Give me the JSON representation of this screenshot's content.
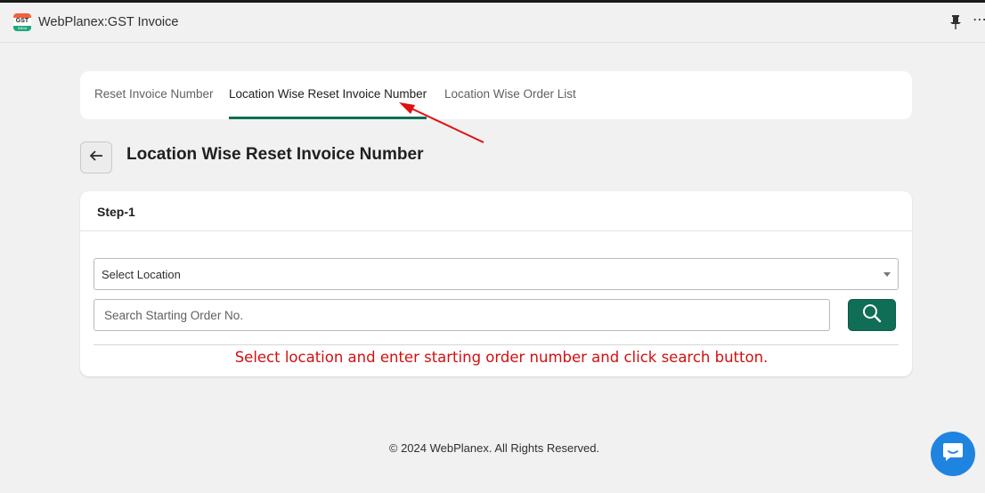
{
  "app": {
    "title": "WebPlanex:GST Invoice",
    "logo": {
      "line1": "GST",
      "line2": "INDIA",
      "colors": {
        "top": "#f0623f",
        "bottom": "#1fa77a"
      }
    },
    "header_icons": [
      "pin-icon",
      "more-icon"
    ]
  },
  "tabs": [
    {
      "label": "Reset Invoice Number",
      "active": false
    },
    {
      "label": "Location Wise Reset Invoice Number",
      "active": true
    },
    {
      "label": "Location Wise Order List",
      "active": false
    }
  ],
  "page": {
    "title": "Location Wise Reset Invoice Number",
    "back_icon": "arrow-left-icon"
  },
  "step": {
    "title": "Step-1",
    "location_select": {
      "value": "Select Location",
      "icon": "chevron-down-icon"
    },
    "order_search": {
      "placeholder": "Search Starting Order No.",
      "value": ""
    },
    "search_button": {
      "icon": "search-icon"
    },
    "instruction": "Select location and enter starting order number and click search button."
  },
  "footer": {
    "text": "© 2024 WebPlanex. All Rights Reserved."
  },
  "chat": {
    "icon": "chat-icon"
  },
  "colors": {
    "accent": "#0f6e55",
    "instruction": "#d40f0f",
    "annotation_arrow": "#e01010",
    "chat": "#1f84e0",
    "background": "#f1f1f1"
  }
}
